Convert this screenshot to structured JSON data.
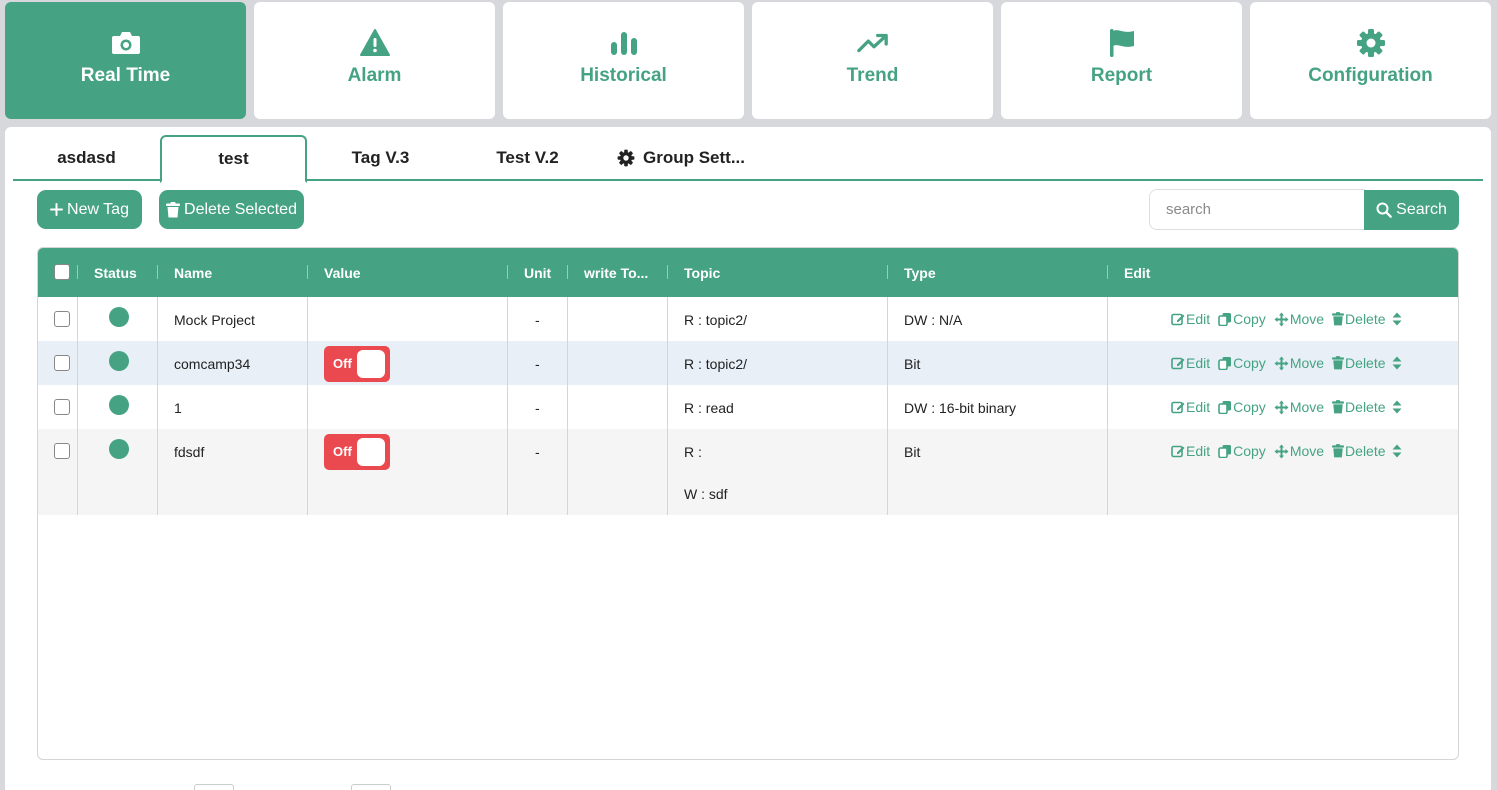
{
  "nav": [
    {
      "label": "Real Time",
      "icon": "camera-icon",
      "active": true
    },
    {
      "label": "Alarm",
      "icon": "warning-icon",
      "active": false
    },
    {
      "label": "Historical",
      "icon": "bar-chart-icon",
      "active": false
    },
    {
      "label": "Trend",
      "icon": "trend-icon",
      "active": false
    },
    {
      "label": "Report",
      "icon": "flag-icon",
      "active": false
    },
    {
      "label": "Configuration",
      "icon": "gear-icon",
      "active": false
    }
  ],
  "tabs": [
    {
      "label": "asdasd",
      "active": false
    },
    {
      "label": "test",
      "active": true
    },
    {
      "label": "Tag V.3",
      "active": false
    },
    {
      "label": "Test V.2",
      "active": false
    },
    {
      "label": "Group Sett...",
      "icon": "gear-icon",
      "active": false
    }
  ],
  "toolbar": {
    "new_tag": "New Tag",
    "delete_selected": "Delete Selected",
    "search_placeholder": "search",
    "search_button": "Search"
  },
  "table": {
    "columns": [
      "Status",
      "Name",
      "Value",
      "Unit",
      "write To...",
      "Topic",
      "Type",
      "Edit"
    ],
    "rows": [
      {
        "name": "Mock Project",
        "value": "",
        "unit": "-",
        "write_to": "",
        "topic_read": "R : topic2/",
        "topic_write": "",
        "type": "DW : N/A"
      },
      {
        "name": "comcamp34",
        "value": "Off",
        "unit": "-",
        "write_to": "",
        "topic_read": "R : topic2/",
        "topic_write": "",
        "type": "Bit"
      },
      {
        "name": "1",
        "value": "",
        "unit": "-",
        "write_to": "",
        "topic_read": "R : read",
        "topic_write": "",
        "type": "DW : 16-bit binary"
      },
      {
        "name": "fdsdf",
        "value": "Off",
        "unit": "-",
        "write_to": "",
        "topic_read": "R :",
        "topic_write": "W : sdf",
        "type": "Bit"
      }
    ],
    "actions": [
      "Edit",
      "Copy",
      "Move",
      "Delete"
    ]
  },
  "colors": {
    "accent": "#45a383",
    "toggle_off": "#ea4a4f",
    "row_highlight": "#e8eff7",
    "row_alt": "#f5f5f5"
  }
}
